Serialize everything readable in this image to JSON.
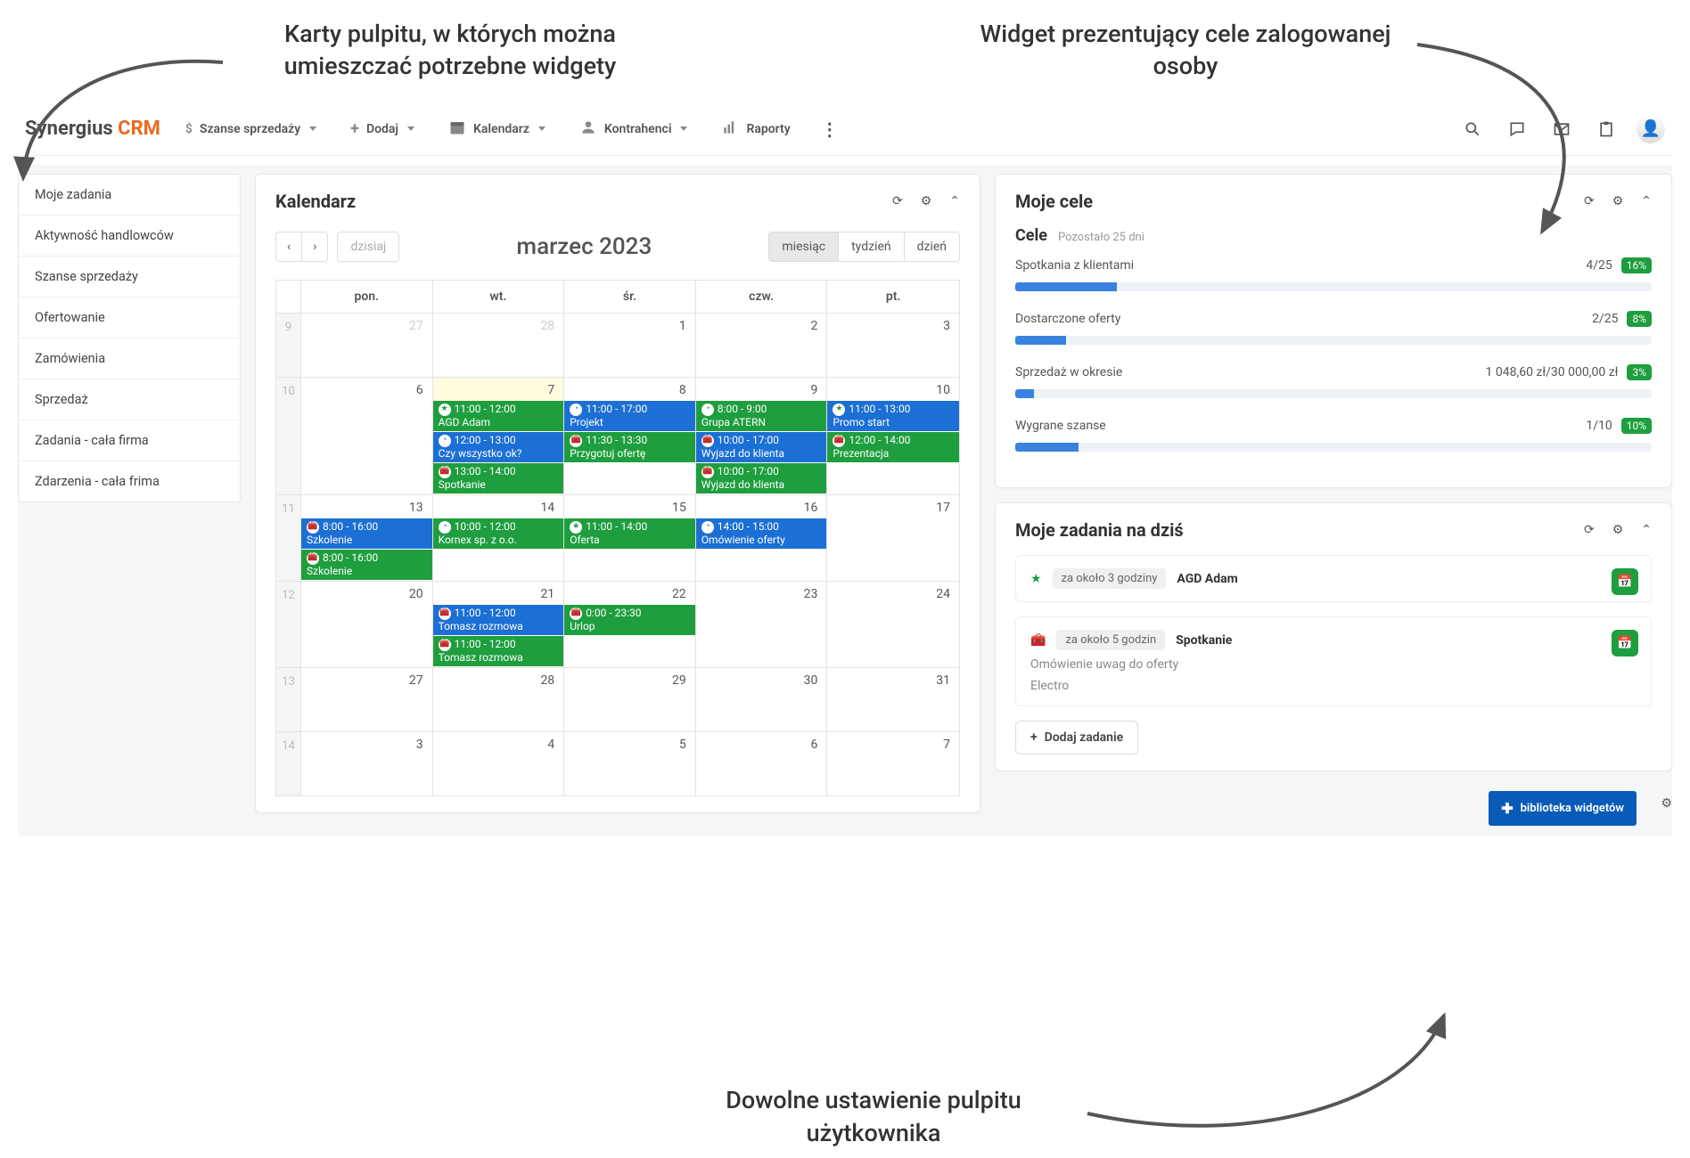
{
  "annotations": {
    "top_left": "Karty pulpitu, w których można umieszczać potrzebne widgety",
    "top_right": "Widget prezentujący cele zalogowanej osoby",
    "bottom": "Dowolne ustawienie pulpitu użytkownika"
  },
  "topbar": {
    "logo1": "Synergius ",
    "logo2": "CRM",
    "nav": {
      "sales": "Szanse sprzedaży",
      "add": "Dodaj",
      "calendar": "Kalendarz",
      "contractors": "Kontrahenci",
      "reports": "Raporty"
    }
  },
  "sidebar": {
    "items": [
      {
        "label": "Moje zadania"
      },
      {
        "label": "Aktywność handlowców"
      },
      {
        "label": "Szanse sprzedaży"
      },
      {
        "label": "Ofertowanie"
      },
      {
        "label": "Zamówienia"
      },
      {
        "label": "Sprzedaż"
      },
      {
        "label": "Zadania - cała firma"
      },
      {
        "label": "Zdarzenia - cała frima"
      }
    ]
  },
  "calendar": {
    "title": "Kalendarz",
    "month": "marzec 2023",
    "today": "dzisiaj",
    "views": {
      "month": "miesiąc",
      "week": "tydzień",
      "day": "dzień"
    },
    "dow": [
      "pon.",
      "wt.",
      "śr.",
      "czw.",
      "pt."
    ],
    "rows": [
      {
        "wk": "9",
        "days": [
          {
            "n": "27",
            "fade": true,
            "ev": []
          },
          {
            "n": "28",
            "fade": true,
            "ev": []
          },
          {
            "n": "1",
            "ev": []
          },
          {
            "n": "2",
            "ev": []
          },
          {
            "n": "3",
            "ev": []
          }
        ]
      },
      {
        "wk": "10",
        "days": [
          {
            "n": "6",
            "ev": []
          },
          {
            "n": "7",
            "hl": true,
            "ev": [
              {
                "c": "green",
                "i": "star",
                "t": "11:00 - 12:00",
                "s": "AGD Adam"
              },
              {
                "c": "blue",
                "i": "clock",
                "t": "12:00 - 13:00",
                "s": "Czy wszystko ok?"
              },
              {
                "c": "green",
                "i": "brief",
                "t": "13:00 - 14:00",
                "s": "Spotkanie"
              }
            ]
          },
          {
            "n": "8",
            "ev": [
              {
                "c": "blue",
                "i": "clock",
                "t": "11:00 - 17:00",
                "s": "Projekt"
              },
              {
                "c": "green",
                "i": "brief",
                "t": "11:30 - 13:30",
                "s": "Przygotuj ofertę"
              }
            ]
          },
          {
            "n": "9",
            "ev": [
              {
                "c": "green",
                "i": "clock",
                "t": "8:00 - 9:00",
                "s": "Grupa ATERN"
              },
              {
                "c": "blue",
                "i": "brief",
                "t": "10:00 - 17:00",
                "s": "Wyjazd do klienta"
              },
              {
                "c": "green",
                "i": "brief",
                "t": "10:00 - 17:00",
                "s": "Wyjazd do klienta"
              }
            ]
          },
          {
            "n": "10",
            "ev": [
              {
                "c": "blue",
                "i": "star",
                "t": "11:00 - 13:00",
                "s": "Promo start"
              },
              {
                "c": "green",
                "i": "brief",
                "t": "12:00 - 14:00",
                "s": "Prezentacja"
              }
            ]
          }
        ]
      },
      {
        "wk": "11",
        "days": [
          {
            "n": "13",
            "ev": [
              {
                "c": "blue",
                "i": "brief",
                "t": "8:00 - 16:00",
                "s": "Szkolenie"
              },
              {
                "c": "green",
                "i": "brief",
                "t": "8:00 - 16:00",
                "s": "Szkolenie"
              }
            ]
          },
          {
            "n": "14",
            "ev": [
              {
                "c": "green",
                "i": "clock",
                "t": "10:00 - 12:00",
                "s": "Kornex sp. z o.o."
              }
            ]
          },
          {
            "n": "15",
            "ev": [
              {
                "c": "green",
                "i": "star",
                "t": "11:00 - 14:00",
                "s": "Oferta"
              }
            ]
          },
          {
            "n": "16",
            "ev": [
              {
                "c": "blue",
                "i": "clock",
                "t": "14:00 - 15:00",
                "s": "Omówienie oferty"
              }
            ]
          },
          {
            "n": "17",
            "ev": []
          }
        ]
      },
      {
        "wk": "12",
        "days": [
          {
            "n": "20",
            "ev": []
          },
          {
            "n": "21",
            "ev": [
              {
                "c": "blue",
                "i": "brief",
                "t": "11:00 - 12:00",
                "s": "Tomasz rozmowa"
              },
              {
                "c": "green",
                "i": "brief",
                "t": "11:00 - 12:00",
                "s": "Tomasz rozmowa"
              }
            ]
          },
          {
            "n": "22",
            "ev": [
              {
                "c": "green",
                "i": "brief",
                "t": "0:00 - 23:30",
                "s": "Urlop"
              }
            ]
          },
          {
            "n": "23",
            "ev": []
          },
          {
            "n": "24",
            "ev": []
          }
        ]
      },
      {
        "wk": "13",
        "days": [
          {
            "n": "27",
            "ev": []
          },
          {
            "n": "28",
            "ev": []
          },
          {
            "n": "29",
            "ev": []
          },
          {
            "n": "30",
            "ev": []
          },
          {
            "n": "31",
            "ev": []
          }
        ]
      },
      {
        "wk": "14",
        "days": [
          {
            "n": "3",
            "ev": []
          },
          {
            "n": "4",
            "ev": []
          },
          {
            "n": "5",
            "ev": []
          },
          {
            "n": "6",
            "ev": []
          },
          {
            "n": "7",
            "ev": []
          }
        ]
      }
    ]
  },
  "goals": {
    "title": "Moje cele",
    "section": "Cele",
    "remaining": "Pozostało 25 dni",
    "items": [
      {
        "label": "Spotkania z klientami",
        "value": "4/25",
        "pct": "16%",
        "bar": 16
      },
      {
        "label": "Dostarczone oferty",
        "value": "2/25",
        "pct": "8%",
        "bar": 8
      },
      {
        "label": "Sprzedaż w okresie",
        "value": "1 048,60 zł/30 000,00 zł",
        "pct": "3%",
        "bar": 3
      },
      {
        "label": "Wygrane szanse",
        "value": "1/10",
        "pct": "10%",
        "bar": 10
      }
    ]
  },
  "tasks": {
    "title": "Moje zadania na dziś",
    "items": [
      {
        "icon": "star",
        "time": "za około 3 godziny",
        "title": "AGD Adam"
      },
      {
        "icon": "brief",
        "time": "za około 5 godzin",
        "title": "Spotkanie",
        "desc": "Omówienie uwag do oferty",
        "sub": "Electro"
      }
    ],
    "add": "Dodaj zadanie"
  },
  "library": {
    "label": "biblioteka widgetów"
  }
}
